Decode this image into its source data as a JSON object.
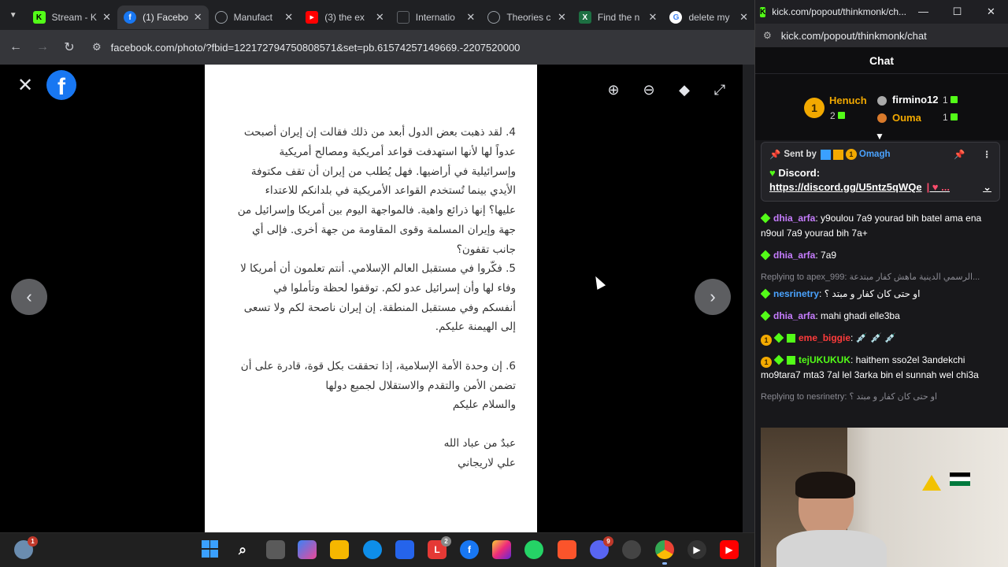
{
  "browser": {
    "tabs": [
      {
        "title": "Stream - K",
        "icon": "kick-icon",
        "color": "#53fc18"
      },
      {
        "title": "(1) Facebo",
        "icon": "facebook-icon",
        "color": "#1877f2",
        "active": true
      },
      {
        "title": "Manufact",
        "icon": "globe-icon",
        "color": "#9aa0a6"
      },
      {
        "title": "(3) the ex",
        "icon": "youtube-icon",
        "color": "#ff0000"
      },
      {
        "title": "Internatio",
        "icon": "doc-icon",
        "color": "#5f6368"
      },
      {
        "title": "Theories c",
        "icon": "globe-icon",
        "color": "#9aa0a6"
      },
      {
        "title": "Find the n",
        "icon": "excel-icon",
        "color": "#1d6f42"
      },
      {
        "title": "delete my",
        "icon": "google-icon",
        "color": "#4285f4"
      }
    ],
    "url": "facebook.com/photo/?fbid=122172794750808571&set=pb.61574257149669.-2207520000"
  },
  "post_text": {
    "p4": "4. لقد ذهبت بعض الدول أبعد من ذلك فقالت إن إيران أصبحت عدواً لها لأنها استهدفت قواعد أمريكية ومصالح أمريكية وإسرائيلية في أراضيها. فهل يُطلب من إيران أن تقف مكتوفة الأيدي بينما تُستخدم القواعد الأمريكية في بلدانكم للاعتداء عليها؟ إنها ذرائع واهية. فالمواجهة اليوم بين أمريكا وإسرائيل من جهة وإيران المسلمة وقوى المقاومة من جهة أخرى. فإلى أي جانب تقفون؟",
    "p5": "5. فكّروا في مستقبل العالم الإسلامي. أنتم تعلمون أن أمريكا لا وفاء لها وأن إسرائيل عدو لكم. توقفوا لحظة وتأملوا في أنفسكم وفي مستقبل المنطقة. إن إيران ناصحة لكم ولا تسعى إلى الهيمنة عليكم.",
    "p6": "6. إن وحدة الأمة الإسلامية، إذا تحققت بكل قوة، قادرة على أن تضمن الأمن والتقدم والاستقلال لجميع دولها",
    "closing": "والسلام عليكم",
    "sig1": "عبدٌ من عباد الله",
    "sig2": "علي لاريجاني"
  },
  "kick": {
    "window_title": "kick.com/popout/thinkmonk/ch...",
    "address": "kick.com/popout/thinkmonk/chat",
    "chat_title": "Chat",
    "podium": {
      "first": {
        "rank": "1",
        "name": "Henuch",
        "count": "2"
      },
      "second": {
        "name": "firmino12",
        "count": "1"
      },
      "third": {
        "name": "Ouma",
        "count": "1"
      }
    },
    "pinned": {
      "sent_by": "Sent by",
      "user": "Omagh",
      "label": "Discord:",
      "link": "https://discord.gg/U5ntz5qWQe"
    },
    "messages": [
      {
        "user": "dhia_arfa",
        "color": "#c77dff",
        "text": "y9oulou 7a9 yourad bih batel ama ena n9oul 7a9 yourad bih 7a+"
      },
      {
        "user": "dhia_arfa",
        "color": "#c77dff",
        "text": "7a9"
      },
      {
        "reply": "Replying to apex_999: الرسمي الدينية ماهش كفار مبتدعة...",
        "user": "nesrinetry",
        "color": "#4aa3ff",
        "text": "او حتى كان كفار و مبتد ؟"
      },
      {
        "user": "dhia_arfa",
        "color": "#c77dff",
        "text": "mahi ghadi elle3ba"
      },
      {
        "user": "eme_biggie",
        "color": "#ff3b3b",
        "text": "💉 💉 💉"
      },
      {
        "user": "tejUKUKUK",
        "color": "#53fc18",
        "text": "haithem sso2el 3andekchi mo9tara7 mta3 7al lel 3arka bin el sunnah wel chi3a"
      },
      {
        "reply": "Replying to nesrinetry: او حتى كان كفار و مبتد ؟",
        "user": "",
        "color": "#fff",
        "text": ""
      }
    ]
  }
}
